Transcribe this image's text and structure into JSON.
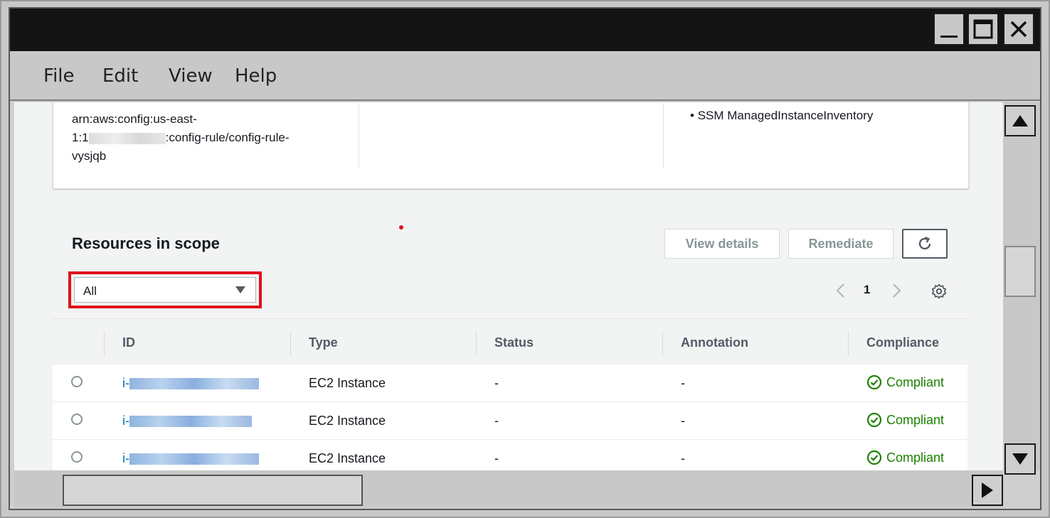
{
  "menu": {
    "items": [
      "File",
      "Edit",
      "View",
      "Help"
    ]
  },
  "window_controls": {
    "minimize": "minimize-icon",
    "maximize": "maximize-icon",
    "close": "close-icon"
  },
  "rule_info": {
    "arn_line1": "arn:aws:config:us-east-",
    "arn_line2_prefix": "1:1",
    "arn_line2_suffix": ":config-rule/config-rule-",
    "arn_line3": "vysjqb",
    "resource_types": [
      "SSM ManagedInstanceInventory"
    ]
  },
  "resources": {
    "title": "Resources in scope",
    "view_details_label": "View details",
    "remediate_label": "Remediate",
    "filter_value": "All",
    "page_number": "1",
    "columns": [
      "ID",
      "Type",
      "Status",
      "Annotation",
      "Compliance"
    ],
    "rows": [
      {
        "id_prefix": "i-",
        "type": "EC2 Instance",
        "status": "-",
        "annotation": "-",
        "compliance": "Compliant"
      },
      {
        "id_prefix": "i-",
        "type": "EC2 Instance",
        "status": "-",
        "annotation": "-",
        "compliance": "Compliant"
      },
      {
        "id_prefix": "i-",
        "type": "EC2 Instance",
        "status": "-",
        "annotation": "-",
        "compliance": "Compliant"
      }
    ]
  },
  "colors": {
    "highlight": "#e0101a",
    "link": "#0073bb",
    "compliant": "#1d8102",
    "titlebar": "#141414"
  }
}
